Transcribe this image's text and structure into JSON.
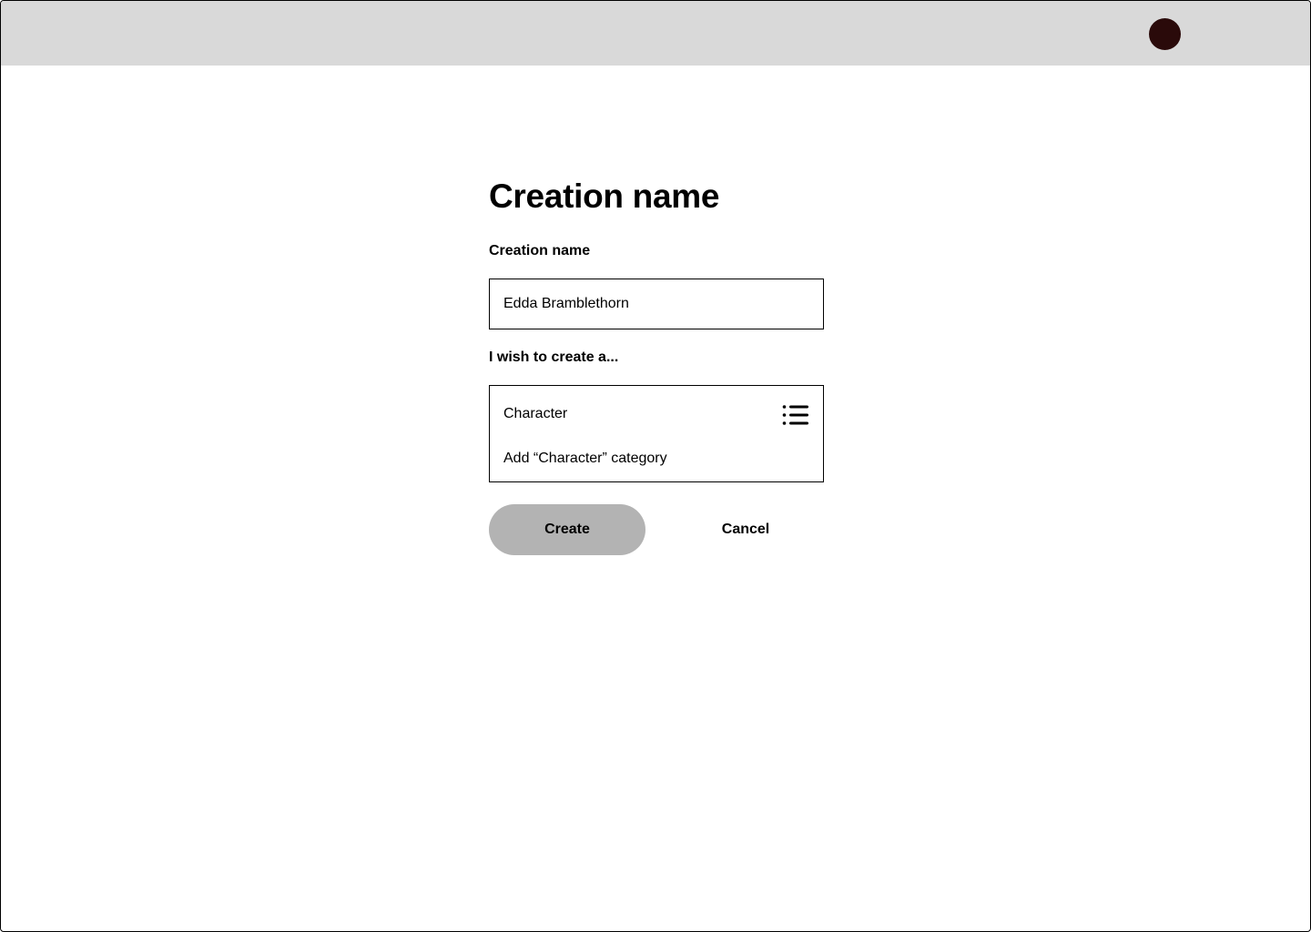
{
  "header": {
    "avatar_icon": "user-avatar-circle",
    "avatar_color": "#2a0a0a",
    "bar_color": "#d9d9d9"
  },
  "form": {
    "title": "Creation name",
    "name_label": "Creation name",
    "name_value": "Edda Bramblethorn",
    "type_label": "I wish to create a...",
    "type_value": "Character",
    "type_icon": "list-icon",
    "add_category_label": "Add “Character” category",
    "create_label": "Create",
    "cancel_label": "Cancel",
    "create_button_color": "#b3b3b3"
  }
}
